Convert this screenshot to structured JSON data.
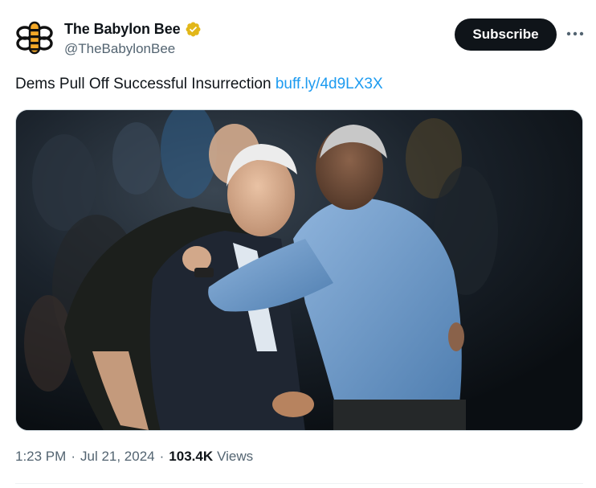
{
  "author": {
    "display_name": "The Babylon Bee",
    "handle": "@TheBabylonBee",
    "avatar_icon": "bee-logo-icon",
    "verified_icon": "verified-gold-badge-icon",
    "verified_color": "#e2b719"
  },
  "actions": {
    "subscribe_label": "Subscribe",
    "more_icon": "more-horizontal-icon"
  },
  "tweet": {
    "text": "Dems Pull Off Successful Insurrection",
    "link": "buff.ly/4d9LX3X"
  },
  "meta": {
    "time": "1:23 PM",
    "separator": "·",
    "date": "Jul 21, 2024",
    "views_count": "103.4K",
    "views_label": "Views"
  },
  "colors": {
    "text_primary": "#0f1419",
    "text_secondary": "#536471",
    "link": "#1d9bf0",
    "button_bg": "#0f1419"
  }
}
